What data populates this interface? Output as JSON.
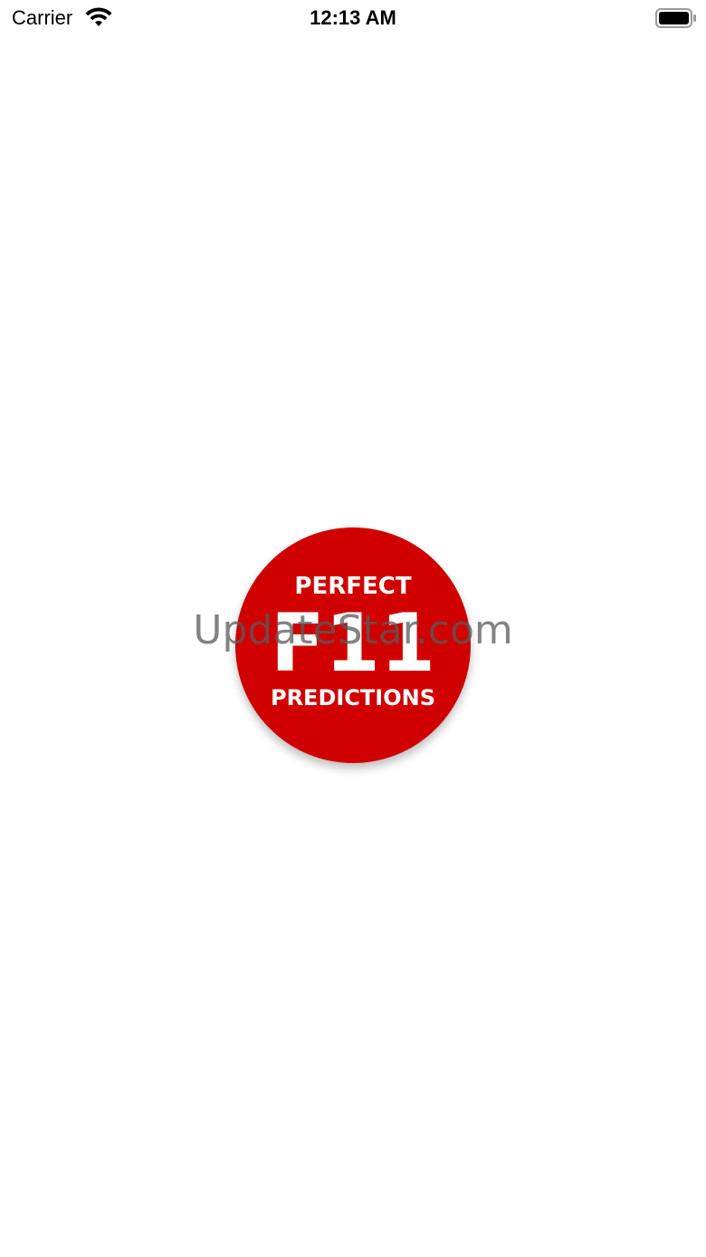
{
  "status_bar": {
    "carrier": "Carrier",
    "time": "12:13 AM",
    "wifi_icon": "wifi-icon",
    "battery_icon": "battery-icon"
  },
  "splash": {
    "logo_line1": "PERFECT",
    "logo_main": "F11",
    "logo_line2": "PREDICTIONS",
    "logo_color": "#d10000"
  },
  "watermark": {
    "text": "UpdateStar.com"
  }
}
